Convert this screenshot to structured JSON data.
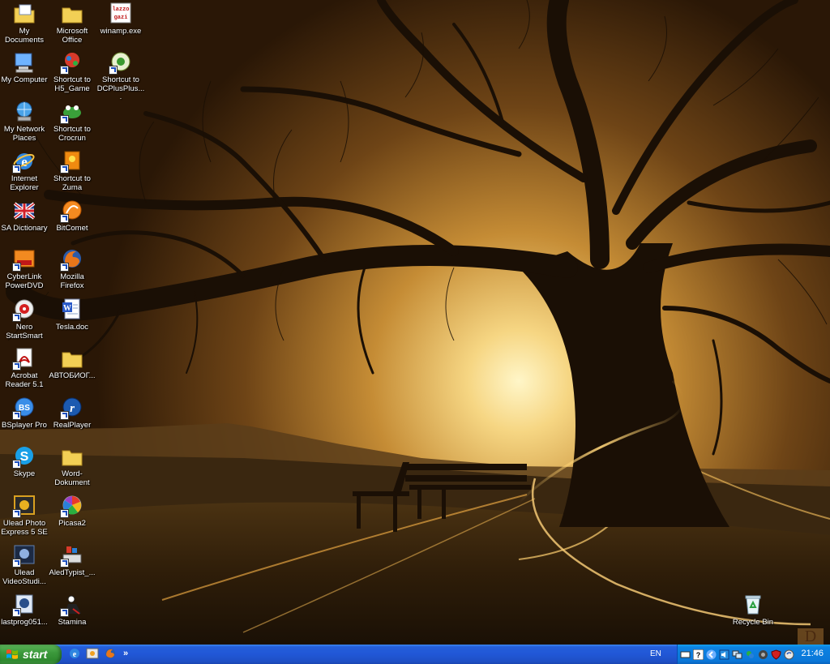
{
  "desktop": {
    "icons": [
      {
        "label": "My Documents"
      },
      {
        "label": "Microsoft Office"
      },
      {
        "label": "winamp.exe"
      },
      {
        "label": "My Computer"
      },
      {
        "label": "Shortcut to H5_Game"
      },
      {
        "label": "Shortcut to DCPlusPlus...."
      },
      {
        "label": "My Network Places"
      },
      {
        "label": "Shortcut to Crocrun"
      },
      {
        "label": "Internet Explorer"
      },
      {
        "label": "Shortcut to Zuma"
      },
      {
        "label": "SA Dictionary"
      },
      {
        "label": "BitComet"
      },
      {
        "label": "CyberLink PowerDVD"
      },
      {
        "label": "Mozilla Firefox"
      },
      {
        "label": "Nero StartSmart"
      },
      {
        "label": "Tesla.doc"
      },
      {
        "label": "Acrobat Reader 5.1"
      },
      {
        "label": "АВТОБИОГ..."
      },
      {
        "label": "BSplayer Pro"
      },
      {
        "label": "RealPlayer"
      },
      {
        "label": "Skype"
      },
      {
        "label": "Word-Dokument"
      },
      {
        "label": "Ulead Photo Express 5 SE"
      },
      {
        "label": "Picasa2"
      },
      {
        "label": "Ulead VideoStudi..."
      },
      {
        "label": "AledTypist_..."
      },
      {
        "label": "lastprog051..."
      },
      {
        "label": "Stamina"
      },
      {
        "label": "Recycle Bin"
      }
    ],
    "winamp_icon_text": [
      "lazzo",
      "gazi"
    ],
    "bsplayer_icon_text": "BS",
    "watermark": "D"
  },
  "taskbar": {
    "start_label": "start",
    "quicklaunch_more": "»",
    "language": "EN",
    "help_glyph": "?",
    "clock": "21:46"
  },
  "colors": {
    "taskbar_blue": "#245edb",
    "start_green": "#3c9a3c",
    "tray_blue": "#0b77d8",
    "sky_gold": "#f4c860"
  }
}
